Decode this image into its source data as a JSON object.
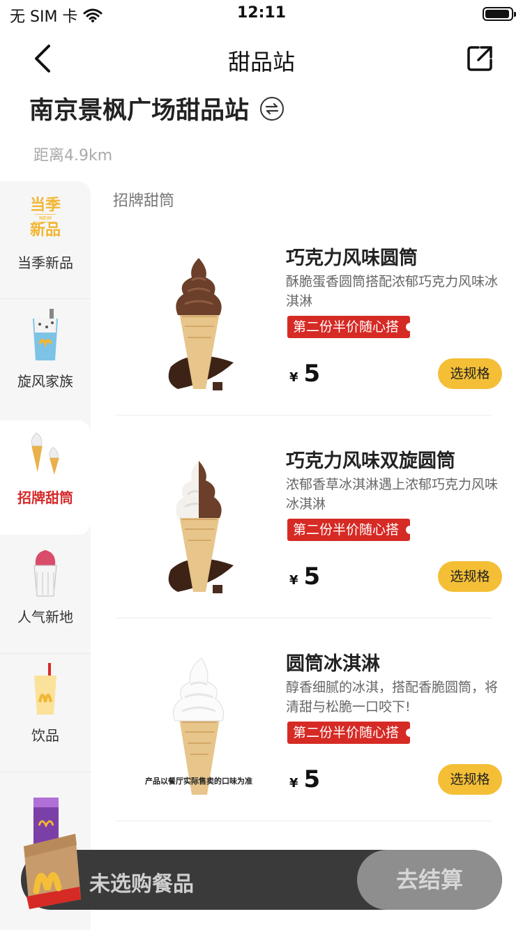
{
  "status_bar": {
    "carrier": "无 SIM 卡",
    "time": "12:11"
  },
  "nav": {
    "title": "甜品站"
  },
  "store": {
    "name": "南京景枫广场甜品站",
    "distance": "距离4.9km"
  },
  "sidebar": {
    "items": [
      {
        "label": "当季新品",
        "badge_top": "当季",
        "badge_mid": "NEW",
        "badge_bottom": "新品",
        "active": false
      },
      {
        "label": "旋风家族",
        "active": false
      },
      {
        "label": "招牌甜筒",
        "active": true
      },
      {
        "label": "人气新地",
        "active": false
      },
      {
        "label": "饮品",
        "active": false
      }
    ]
  },
  "section": {
    "title": "招牌甜筒"
  },
  "products": [
    {
      "name": "巧克力风味圆筒",
      "desc": "酥脆蛋香圆筒搭配浓郁巧克力风味冰淇淋",
      "promo": "第二份半价随心搭",
      "currency": "¥",
      "price": "5",
      "button": "选规格"
    },
    {
      "name": "巧克力风味双旋圆筒",
      "desc": "浓郁香草冰淇淋遇上浓郁巧克力风味冰淇淋",
      "promo": "第二份半价随心搭",
      "currency": "¥",
      "price": "5",
      "button": "选规格"
    },
    {
      "name": "圆筒冰淇淋",
      "desc": "醇香细腻的冰淇，搭配香脆圆筒，将清甜与松脆一口咬下!",
      "promo": "第二份半价随心搭",
      "currency": "¥",
      "price": "5",
      "button": "选规格",
      "image_caption": "产品以餐厅实际售卖的口味为准"
    }
  ],
  "cart": {
    "empty_text": "未选购餐品",
    "checkout": "去结算"
  },
  "colors": {
    "accent_red": "#d62a25",
    "button_yellow": "#f4bf36",
    "cart_dark": "#3a3a3a"
  }
}
